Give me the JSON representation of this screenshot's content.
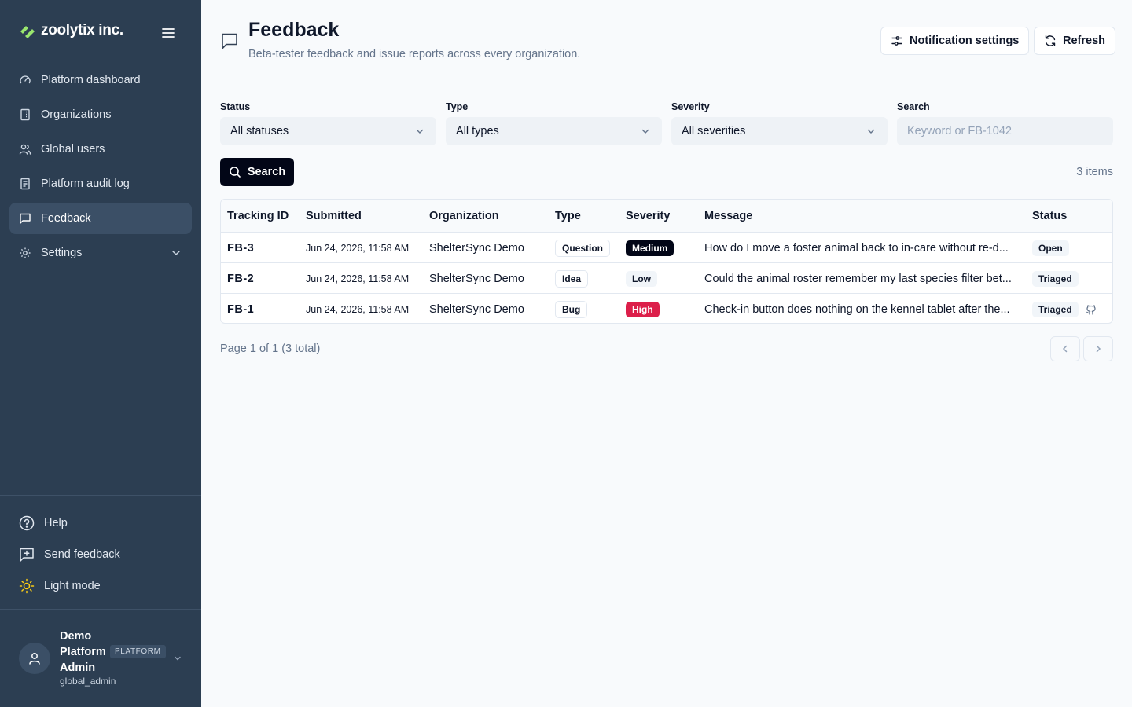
{
  "brand": {
    "name": "zoolytix inc.",
    "logo_color": "#9ae66e"
  },
  "sidebar": {
    "items": [
      {
        "label": "Platform dashboard",
        "icon": "gauge-icon"
      },
      {
        "label": "Organizations",
        "icon": "building-icon"
      },
      {
        "label": "Global users",
        "icon": "users-icon"
      },
      {
        "label": "Platform audit log",
        "icon": "file-icon"
      },
      {
        "label": "Feedback",
        "icon": "message-square-icon",
        "active": true
      },
      {
        "label": "Settings",
        "icon": "gear-icon"
      }
    ],
    "bottom": [
      {
        "label": "Help",
        "icon": "help-circle-icon"
      },
      {
        "label": "Send feedback",
        "icon": "message-plus-icon"
      },
      {
        "label": "Light mode",
        "icon": "sun-icon"
      }
    ],
    "user": {
      "name": "Demo Platform Admin",
      "badge": "PLATFORM",
      "role": "global_admin"
    }
  },
  "header": {
    "title": "Feedback",
    "subtitle": "Beta-tester feedback and issue reports across every organization.",
    "notify_label": "Notification settings",
    "refresh_label": "Refresh"
  },
  "filters": {
    "status": {
      "label": "Status",
      "value": "All statuses"
    },
    "type": {
      "label": "Type",
      "value": "All types"
    },
    "severity": {
      "label": "Severity",
      "value": "All severities"
    },
    "search": {
      "label": "Search",
      "placeholder": "Keyword or FB-1042"
    },
    "search_button": "Search",
    "count": "3 items"
  },
  "table": {
    "columns": [
      "Tracking ID",
      "Submitted",
      "Organization",
      "Type",
      "Severity",
      "Message",
      "Status"
    ],
    "rows": [
      {
        "id": "FB-3",
        "submitted": "Jun 24, 2026, 11:58 AM",
        "org": "ShelterSync Demo",
        "type": "Question",
        "severity": "Medium",
        "message": "How do I move a foster animal back to in-care without re-d...",
        "status": "Open"
      },
      {
        "id": "FB-2",
        "submitted": "Jun 24, 2026, 11:58 AM",
        "org": "ShelterSync Demo",
        "type": "Idea",
        "severity": "Low",
        "message": "Could the animal roster remember my last species filter bet...",
        "status": "Triaged"
      },
      {
        "id": "FB-1",
        "submitted": "Jun 24, 2026, 11:58 AM",
        "org": "ShelterSync Demo",
        "type": "Bug",
        "severity": "High",
        "message": "Check-in button does nothing on the kennel tablet after the...",
        "status": "Triaged",
        "linked": "github-icon"
      }
    ],
    "severity_colors": {
      "Medium": "#020617",
      "Low": "#f1f5f9",
      "High": "#dc1f4a"
    }
  },
  "pager": {
    "text": "Page 1 of 1 (3 total)"
  }
}
